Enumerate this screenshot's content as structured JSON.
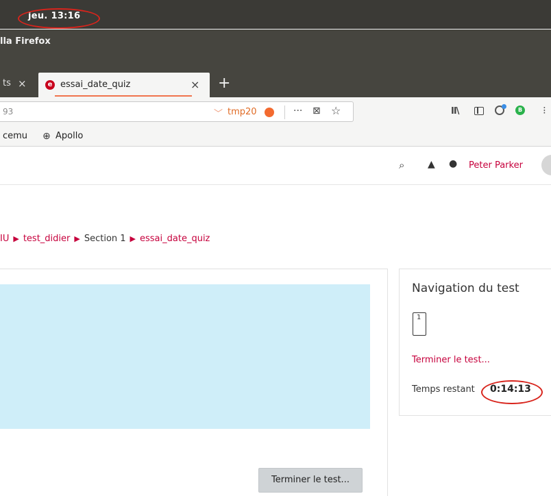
{
  "system_panel": {
    "clock": "jeu. 13:16"
  },
  "window": {
    "title": "lla Firefox"
  },
  "tabs": {
    "previous_label": "ts",
    "previous_close": "×",
    "active_label": "essai_date_quiz",
    "active_close": "×",
    "new_tab": "+"
  },
  "url_bar": {
    "url_fragment": "93",
    "chevron": "﹀",
    "container_badge": "tmp20",
    "page_actions": "···",
    "pocket": "⊠",
    "bookmark_star": "☆"
  },
  "toolbar": {
    "library": "II\\",
    "more": "⁝"
  },
  "bookmarks": {
    "item1": "cemu",
    "item2": "Apollo",
    "item2_icon": "⊕"
  },
  "page_header": {
    "search_icon": "⌕",
    "bell_icon": "▲",
    "message_icon": "●",
    "user_name": "Peter Parker"
  },
  "breadcrumb": {
    "item1": "IU",
    "item2": "test_didier",
    "item3": "Section 1",
    "item4": "essai_date_quiz",
    "separator": "▶"
  },
  "main": {
    "finish_button": "Terminer le test..."
  },
  "quiz_nav": {
    "title": "Navigation du test",
    "question_number": "1",
    "finish_link": "Terminer le test...",
    "time_label": "Temps restant",
    "time_value": "0:14:13"
  },
  "colors": {
    "accent": "#c6003c",
    "annotation": "#d8241c",
    "question_bg": "#cfeef9"
  }
}
